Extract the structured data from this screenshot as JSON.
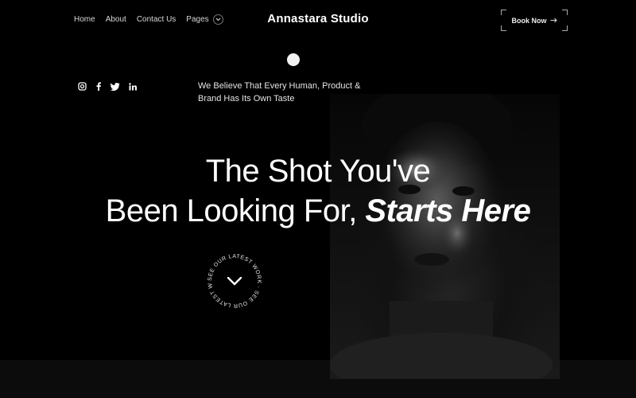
{
  "nav": {
    "home": "Home",
    "about": "About",
    "contact": "Contact Us",
    "pages": "Pages"
  },
  "brand": "Annastara Studio",
  "book_now": "Book Now",
  "tagline": {
    "line1": "We Believe That Every Human, Product &",
    "line2": "Brand Has Its Own Taste"
  },
  "headline": {
    "line1": "The Shot You've",
    "line2_plain": "Been Looking For, ",
    "line2_emphasis": "Starts Here"
  },
  "badge_text": "SEE OUR LATEST WORK · SEE OUR LATEST WORK ·",
  "social_icons": [
    "instagram-icon",
    "facebook-icon",
    "twitter-icon",
    "linkedin-icon"
  ],
  "colors": {
    "background": "#000000",
    "text": "#ffffff",
    "muted": "#d6d6d6"
  }
}
